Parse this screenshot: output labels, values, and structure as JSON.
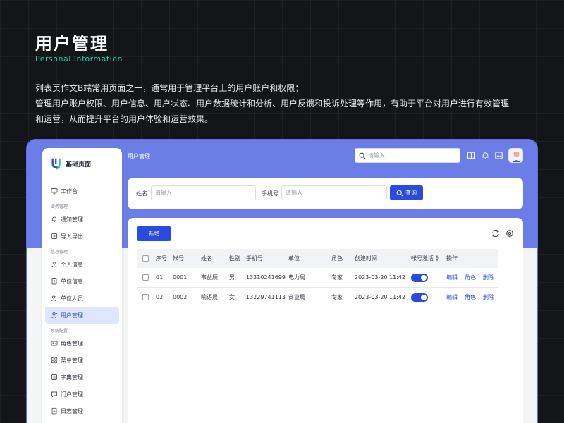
{
  "intro": {
    "title": "用户管理",
    "subtitle": "Personal Information",
    "desc_line1": "列表页作文B端常用页面之一，通常用于管理平台上的用户账户和权限；",
    "desc_line2": "管理用户账户权限、用户信息、用户状态、用户数据统计和分析、用户反馈和投诉处理等作用，有助于平台对用户进行有效管理",
    "desc_line3": "和运营，从而提升平台的用户体验和运营效果。"
  },
  "brand": {
    "name": "基础页面"
  },
  "sidebar": {
    "workbench": "工作台",
    "group_business": "业务管理",
    "notice": "通知管理",
    "import_export": "导入导出",
    "group_info": "信息管理",
    "personal_info": "个人信息",
    "unit_info": "单位信息",
    "unit_staff": "单位人员",
    "user_mgmt": "用户管理",
    "group_system": "系统配置",
    "role_mgmt": "角色管理",
    "menu_mgmt": "菜单管理",
    "dict_mgmt": "字典管理",
    "portal_mgmt": "门户管理",
    "log_mgmt": "日志管理"
  },
  "header": {
    "breadcrumb": "用户管理",
    "search_placeholder": "请输入"
  },
  "filter": {
    "name_label": "姓名",
    "name_placeholder": "请输入",
    "phone_label": "手机号",
    "phone_placeholder": "请输入",
    "query_label": "查询"
  },
  "table": {
    "add_label": "新增",
    "headers": {
      "seq": "序号",
      "account": "帐号",
      "name": "姓名",
      "gender": "性别",
      "phone": "手机号",
      "unit": "单位",
      "role": "角色",
      "created": "创建时间",
      "active": "帐号激活",
      "ops": "操作"
    },
    "rows": [
      {
        "seq": "01",
        "account": "0001",
        "name": "韦益辰",
        "gender": "男",
        "phone": "13310241699",
        "unit": "电力局",
        "role": "专家",
        "created": "2023-03-20 11:42",
        "active": true
      },
      {
        "seq": "02",
        "account": "0002",
        "name": "喻语晨",
        "gender": "女",
        "phone": "13229741113",
        "unit": "商业局",
        "role": "专家",
        "created": "2023-03-20 11:42",
        "active": true
      }
    ],
    "op_edit": "编辑",
    "op_role": "角色",
    "op_delete": "删除"
  },
  "colors": {
    "accent": "#2a4be0",
    "band": "#6b7ee7",
    "subtitle": "#2cc9a8",
    "background": "#141518"
  },
  "icons": [
    "search-icon",
    "book-icon",
    "bell-icon",
    "image-icon",
    "refresh-icon",
    "settings-icon"
  ]
}
